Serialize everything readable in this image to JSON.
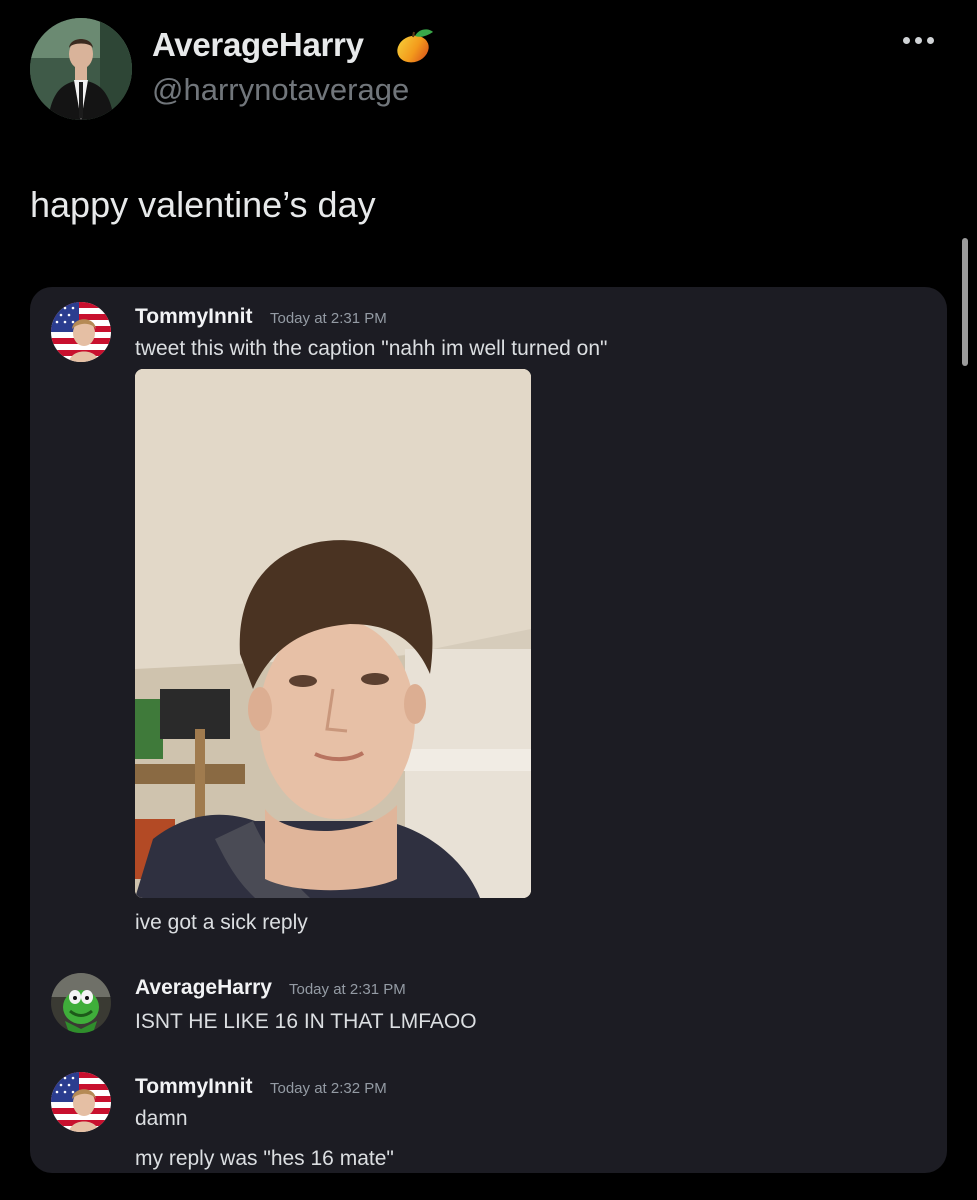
{
  "tweet": {
    "display_name": "AverageHarry",
    "handle": "@harrynotaverage",
    "text": "happy valentine’s day",
    "badge_icon": "mango-icon",
    "menu_icon": "more-options-icon"
  },
  "discord": {
    "messages": [
      {
        "username": "TommyInnit",
        "timestamp": "Today at 2:31 PM",
        "lines": [
          "tweet this with the caption \"nahh im well turned on\""
        ],
        "attachment": "selfie-photo",
        "after": "ive got a sick reply"
      },
      {
        "username": "AverageHarry",
        "timestamp": "Today at 2:31 PM",
        "lines": [
          "ISNT HE LIKE 16 IN THAT LMFAOO"
        ]
      },
      {
        "username": "TommyInnit",
        "timestamp": "Today at 2:32 PM",
        "lines": [
          "damn",
          "my reply was \"hes 16 mate\""
        ]
      }
    ]
  },
  "colors": {
    "background": "#000000",
    "embed_background": "#1c1c23",
    "handle_gray": "#71767b",
    "timestamp_gray": "#949ba4"
  }
}
